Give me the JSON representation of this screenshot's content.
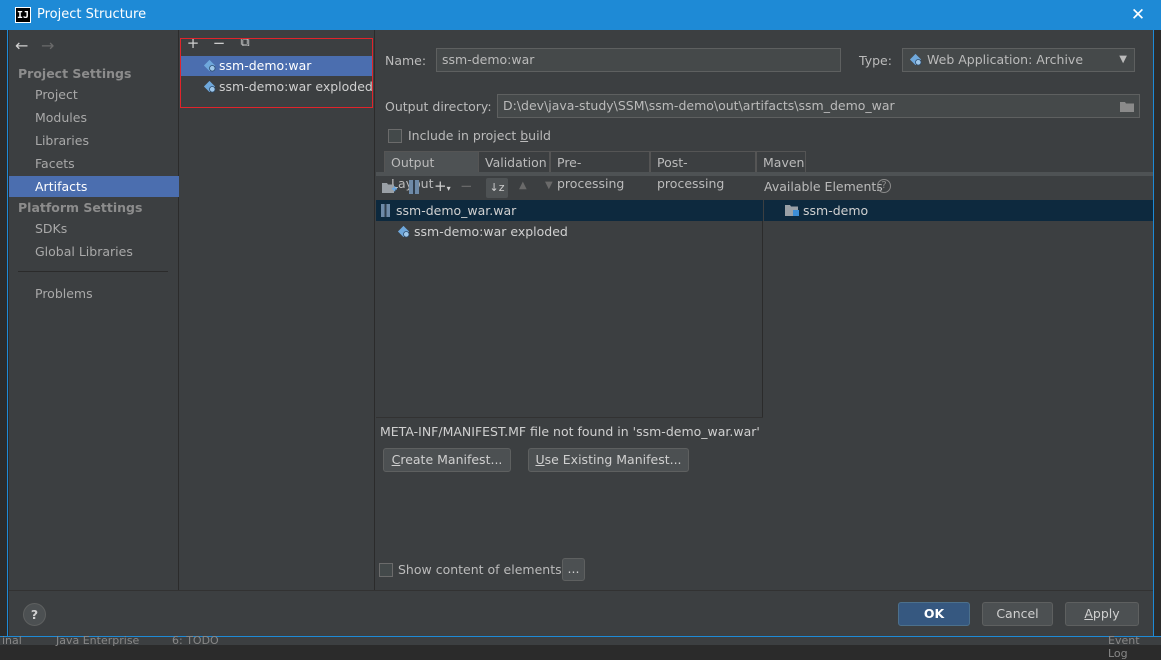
{
  "titlebar": {
    "app_icon": "IJ",
    "title": "Project Structure",
    "close_icon": "✕"
  },
  "nav": {
    "back_icon": "←",
    "forward_icon": "→"
  },
  "sidebar": {
    "project_settings_header": "Project Settings",
    "project_items": [
      {
        "label": "Project"
      },
      {
        "label": "Modules"
      },
      {
        "label": "Libraries"
      },
      {
        "label": "Facets"
      },
      {
        "label": "Artifacts",
        "selected": true
      }
    ],
    "platform_settings_header": "Platform Settings",
    "platform_items": [
      {
        "label": "SDKs"
      },
      {
        "label": "Global Libraries"
      }
    ],
    "problems_label": "Problems"
  },
  "artifacts_toolbar": {
    "add_icon": "+",
    "remove_icon": "−",
    "copy_icon": "⧉"
  },
  "artifacts": [
    {
      "label": "ssm-demo:war",
      "selected": true
    },
    {
      "label": "ssm-demo:war exploded",
      "selected": false
    }
  ],
  "form": {
    "name_label": "Name:",
    "name_value": "ssm-demo:war",
    "type_label": "Type:",
    "type_value": "Web Application: Archive",
    "output_dir_label": "Output directory:",
    "output_dir_value": "D:\\dev\\java-study\\SSM\\ssm-demo\\out\\artifacts\\ssm_demo_war",
    "include_build_label_pre": "Include in project ",
    "include_build_label_ul": "b",
    "include_build_label_post": "uild",
    "include_build_checked": false
  },
  "tabs": [
    {
      "label": "Output Layout",
      "selected": true
    },
    {
      "label": "Validation",
      "selected": false
    },
    {
      "label": "Pre-processing",
      "selected": false
    },
    {
      "label": "Post-processing",
      "selected": false
    },
    {
      "label": "Maven",
      "selected": false
    }
  ],
  "layout": {
    "tree": [
      {
        "label": "ssm-demo_war.war",
        "selected": true
      },
      {
        "label": "ssm-demo:war exploded",
        "selected": false
      }
    ],
    "available_elements_label": "Available Elements",
    "available_items": [
      {
        "label": "ssm-demo"
      }
    ],
    "manifest_message": "META-INF/MANIFEST.MF file not found in 'ssm-demo_war.war'",
    "create_manifest_ul": "C",
    "create_manifest_rest": "reate Manifest...",
    "use_existing_ul": "U",
    "use_existing_rest": "se Existing Manifest...",
    "show_content_label": "Show content of elements",
    "show_content_checked": false,
    "ellipsis_label": "..."
  },
  "footer": {
    "help_label": "?",
    "ok_label": "OK",
    "cancel_label": "Cancel",
    "apply_ul": "A",
    "apply_rest": "pply"
  },
  "background": {
    "status_left": "inal",
    "status_java": "Java Enterprise",
    "status_todo": "6: TODO",
    "status_event": "Event Log"
  },
  "colors": {
    "titlebar": "#1e8ad6",
    "selection": "#4b6eaf",
    "panel": "#3c3f41",
    "highlight_box": "#e0242b",
    "default_button": "#365880"
  }
}
